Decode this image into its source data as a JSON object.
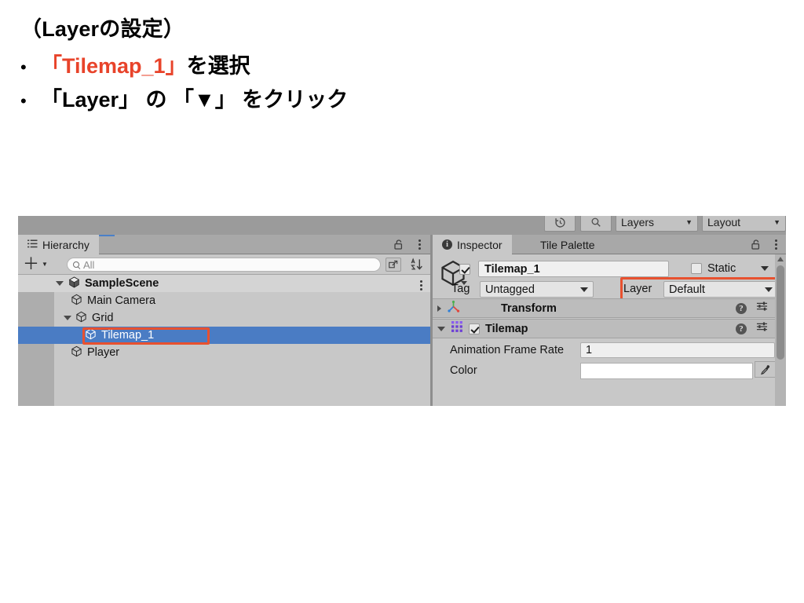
{
  "slide": {
    "title": "（Layerの設定）",
    "bullets": [
      {
        "marker": "•",
        "segments": [
          {
            "text": "「Tilemap_1」",
            "color": "#E8432A"
          },
          {
            "text": " を選択",
            "color": "#000000"
          }
        ]
      },
      {
        "marker": "•",
        "segments": [
          {
            "text": "「Layer」 の 「▼」 をクリック",
            "color": "#000000"
          }
        ]
      }
    ],
    "bullet1_red": "「Tilemap_1」",
    "bullet1_black": " を選択",
    "bullet2": "「Layer」 の 「▼」 をクリック"
  },
  "colors": {
    "accent_red": "#E8432A",
    "highlight_box": "#E8512F",
    "selection_blue": "#4A7CC4",
    "panel_bg": "#C8C8C8",
    "toolbar_bg": "#9B9B9B",
    "component_header": "#BCBCBC",
    "tab_active": "#C8C8C8",
    "tab_strip": "#A8A8A8"
  },
  "toolbar": {
    "history_icon": "history-clock-icon",
    "search_icon": "search-icon",
    "layers_dropdown": {
      "label": "Layers",
      "caret": "▼"
    },
    "layout_dropdown": {
      "label": "Layout",
      "caret": "▼"
    }
  },
  "hierarchy": {
    "tab_label": "Hierarchy",
    "tab_icon": "hierarchy-list-icon",
    "lock_icon": "lock-open-icon",
    "menu_icon": "kebab-menu-icon",
    "add_button": {
      "icon": "plus-icon",
      "caret": "▼"
    },
    "search": {
      "placeholder": "All",
      "icon": "search-icon"
    },
    "open_new_window_icon": "open-in-new-window-icon",
    "sort_icon": "alphabetical-sort-icon",
    "row_menu_icon": "kebab-menu-icon",
    "tree": [
      {
        "label": "SampleScene",
        "indent": 0,
        "twisty": "open",
        "icon": "unity-scene-icon",
        "bold": true,
        "selected": false,
        "scene": true
      },
      {
        "label": "Main Camera",
        "indent": 1,
        "twisty": "none",
        "icon": "gameobject-cube-icon",
        "bold": false,
        "selected": false,
        "scene": false
      },
      {
        "label": "Grid",
        "indent": 1,
        "twisty": "open",
        "icon": "gameobject-cube-icon",
        "bold": false,
        "selected": false,
        "scene": false
      },
      {
        "label": "Tilemap_1",
        "indent": 2,
        "twisty": "none",
        "icon": "gameobject-cube-icon",
        "bold": false,
        "selected": true,
        "scene": false
      },
      {
        "label": "Player",
        "indent": 1,
        "twisty": "none",
        "icon": "gameobject-cube-icon",
        "bold": false,
        "selected": false,
        "scene": false
      }
    ]
  },
  "inspector": {
    "tabs": [
      {
        "label": "Inspector",
        "active": true,
        "icon": "info-icon"
      },
      {
        "label": "Tile Palette",
        "active": false,
        "icon": ""
      }
    ],
    "lock_icon": "lock-open-icon",
    "menu_icon": "kebab-menu-icon",
    "game_object": {
      "prefab_icon": "gameobject-cube-icon",
      "enabled_checkbox": true,
      "name": "Tilemap_1",
      "static_label": "Static",
      "static_checked": false,
      "static_caret": "▼",
      "tag_label": "Tag",
      "tag_value": "Untagged",
      "layer_label": "Layer",
      "layer_value": "Default",
      "layer_highlighted": true
    },
    "components": [
      {
        "name": "Transform",
        "icon": "transform-axis-icon",
        "expanded": false,
        "twisty": "collapsed",
        "has_checkbox": false,
        "help_icon": "help-icon",
        "preset_icon": "preset-sliders-icon",
        "menu_icon": "kebab-menu-icon"
      },
      {
        "name": "Tilemap",
        "icon": "tilemap-grid-icon",
        "expanded": true,
        "twisty": "expanded",
        "has_checkbox": true,
        "checked": true,
        "help_icon": "help-icon",
        "preset_icon": "preset-sliders-icon",
        "menu_icon": "kebab-menu-icon"
      }
    ],
    "properties": [
      {
        "label": "Animation Frame Rate",
        "value": "1",
        "type": "text"
      },
      {
        "label": "Color",
        "value": "",
        "type": "color",
        "eyedropper_icon": "eyedropper-icon"
      }
    ],
    "scrollbar": {
      "up_arrow": "▲"
    }
  }
}
